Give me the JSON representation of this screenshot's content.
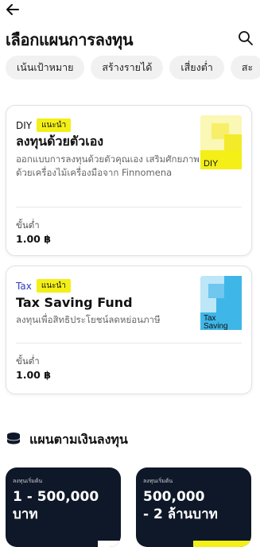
{
  "header": {
    "title": "เลือกแผนการลงทุน"
  },
  "filters": [
    {
      "label": "เน้นเป้าหมาย"
    },
    {
      "label": "สร้างรายได้"
    },
    {
      "label": "เสี่ยงต่ำ"
    },
    {
      "label": "สะ"
    }
  ],
  "cards": [
    {
      "tag": "DIY",
      "badge": "แนะนำ",
      "title": "ลงทุนด้วยตัวเอง",
      "description": "ออกแบบการลงทุนด้วยตัวคุณเอง เสริมศักยภาพด้วยเครื่องไม้เครื่องมือจาก Finnomena",
      "min_label": "ขั้นต่ำ",
      "min_value": "1.00 ฿",
      "illustration_text": "DIY"
    },
    {
      "tag": "Tax",
      "badge": "แนะนำ",
      "title": "Tax Saving Fund",
      "description": "ลงทุนเพื่อสิทธิประโยชน์ลดหย่อนภาษี",
      "min_label": "ขั้นต่ำ",
      "min_value": "1.00 ฿",
      "illustration_text": "Tax Saving"
    }
  ],
  "section": {
    "title": "แผนตามเงินลงทุน"
  },
  "plans": [
    {
      "small": "ลงทุนเริ่มต้น",
      "amount_line1": "1 - 500,000",
      "amount_line2": "บาท"
    },
    {
      "small": "ลงทุนเริ่มต้น",
      "amount_line1": "500,000",
      "amount_line2": "- 2 ล้านบาท"
    }
  ],
  "colors": {
    "badge": "#f3ef17",
    "plan_bg": "#0e1828",
    "tax_tag": "#2f3dbb",
    "diy_illus": "#f3ef17",
    "tax_illus": "#3fb6e8"
  }
}
